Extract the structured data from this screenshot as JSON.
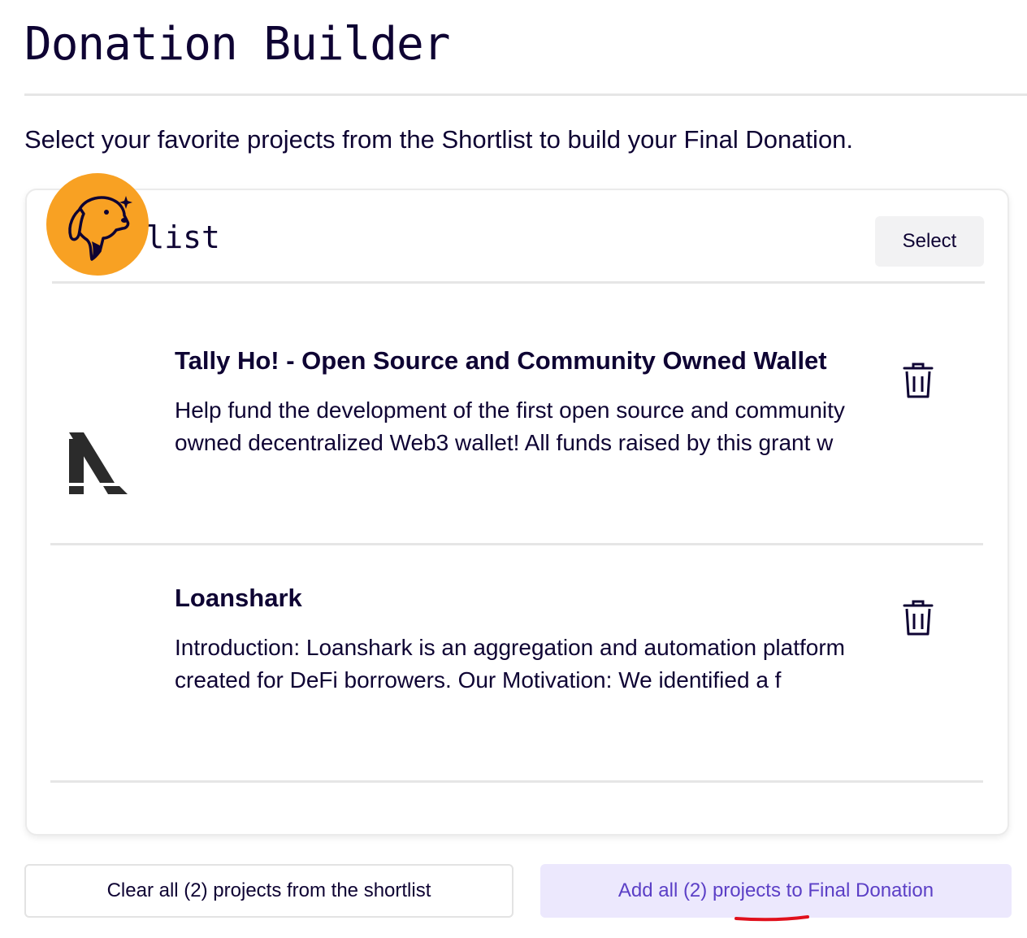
{
  "page": {
    "title": "Donation Builder",
    "subtitle": "Select your favorite projects from the Shortlist to build your Final Donation."
  },
  "shortlist": {
    "title": "Shortlist",
    "select_label": "Select",
    "projects": [
      {
        "title": "Tally Ho! - Open Source and Community Owned Wallet",
        "description": "Help fund the development of the first open source and community owned decentralized Web3 wallet! All funds raised by this grant w",
        "logo": "tally-ho-dog-logo"
      },
      {
        "title": "Loanshark",
        "description": "Introduction: Loanshark is an aggregation and automation platform created for DeFi borrowers. Our Motivation: We identified a f",
        "logo": "loanshark-logo"
      }
    ]
  },
  "actions": {
    "clear_label": "Clear all (2) projects from the shortlist",
    "add_label": "Add all (2) projects to Final Donation"
  },
  "colors": {
    "text": "#0e0333",
    "accent": "#5b3fc6",
    "accent_bg": "#ece8fd",
    "tally_orange": "#f8a123",
    "annotation_red": "#e0101c"
  }
}
